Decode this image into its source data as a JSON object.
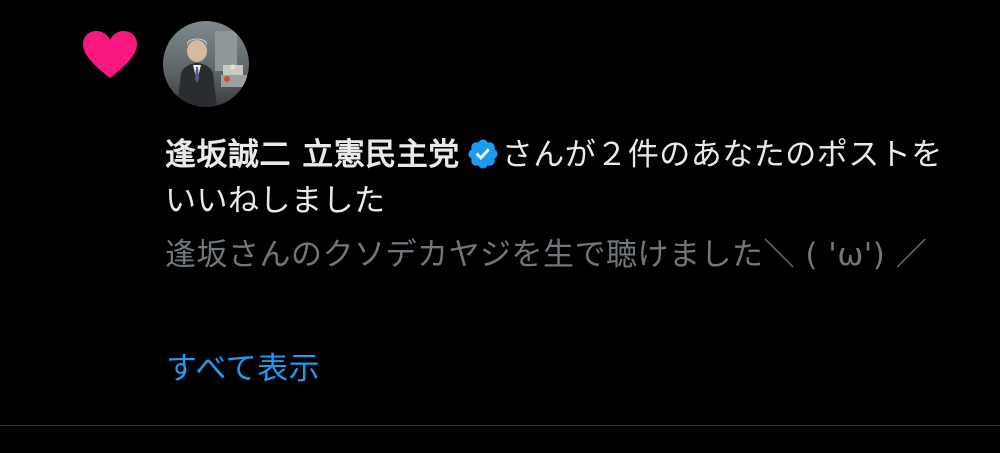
{
  "notification": {
    "icon": "heart-icon",
    "icon_color": "#f91880",
    "avatar": "avatar",
    "user_name": "逢坂誠二 立憲民主党",
    "verified_icon": "verified-badge-icon",
    "verified_color": "#1d9bf0",
    "action_text": "さんが２件のあなたのポストをいいねしました",
    "post_text": "逢坂さんのクソデカヤジを生で聴けました＼ ( 'ω') ／",
    "show_all_label": "すべて表示",
    "link_color": "#1d9bf0"
  }
}
